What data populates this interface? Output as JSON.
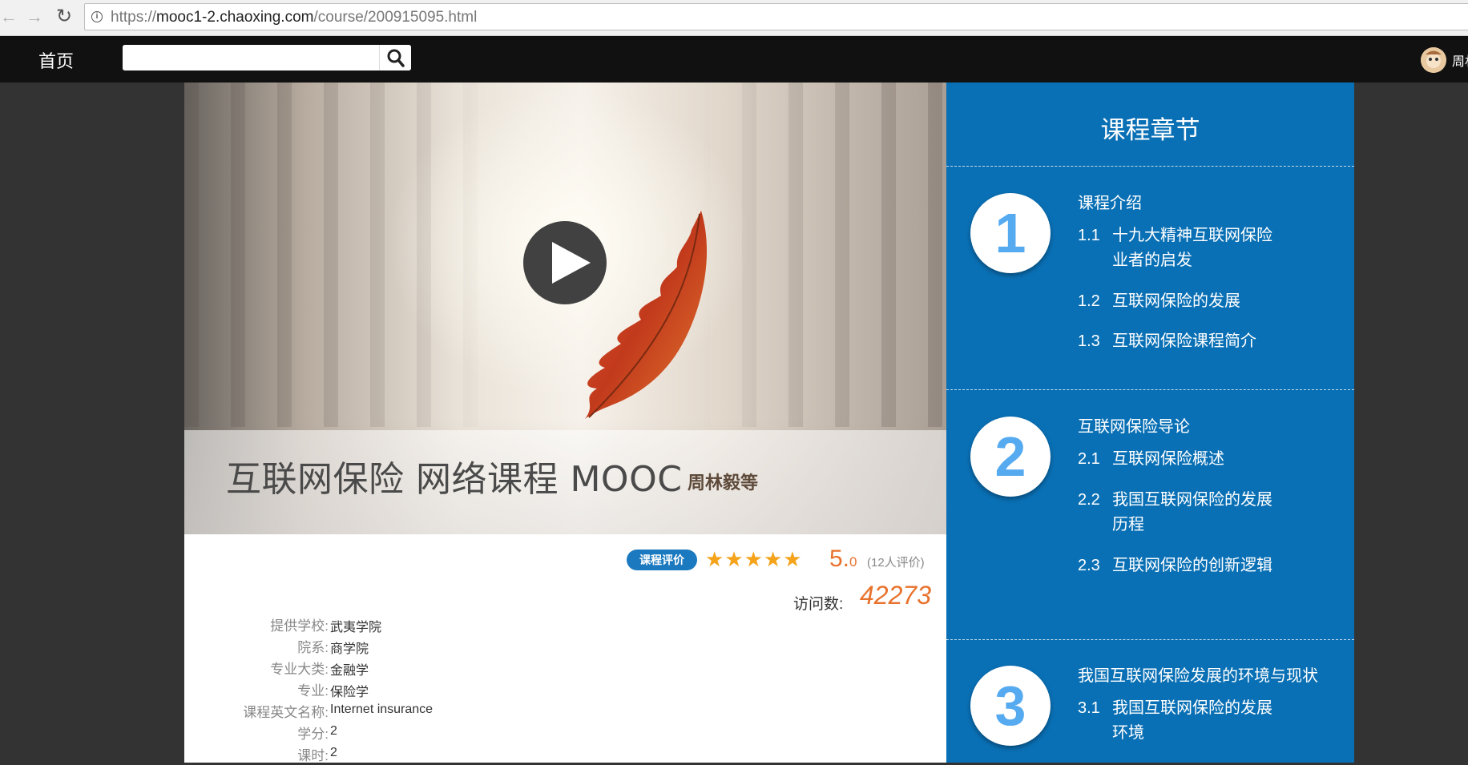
{
  "browser": {
    "url_scheme": "https://",
    "url_host": "mooc1-2.chaoxing.com",
    "url_path": "/course/200915095.html"
  },
  "nav": {
    "home_label": "首页",
    "search_placeholder": "",
    "user_name": "周林"
  },
  "hero": {
    "course_title": "互联网保险 网络课程 MOOC",
    "course_author": "周林毅等"
  },
  "rating": {
    "badge_label": "课程评价",
    "stars": 5,
    "score_int": "5.",
    "score_dec": "0",
    "review_count": "(12人评价)",
    "visits_label": "访问数:",
    "visits_value": "42273"
  },
  "meta": [
    {
      "label": "提供学校:",
      "value": "武夷学院"
    },
    {
      "label": "院系:",
      "value": "商学院"
    },
    {
      "label": "专业大类:",
      "value": "金融学"
    },
    {
      "label": "专业:",
      "value": "保险学"
    },
    {
      "label": "课程英文名称:",
      "value": "Internet insurance"
    },
    {
      "label": "学分:",
      "value": "2"
    },
    {
      "label": "课时:",
      "value": "2"
    }
  ],
  "chapters": {
    "heading": "课程章节",
    "items": [
      {
        "num": "1",
        "title": "课程介绍",
        "sections": [
          {
            "num": "1.1",
            "title": "十九大精神互联网保险业者的启发"
          },
          {
            "num": "1.2",
            "title": "互联网保险的发展"
          },
          {
            "num": "1.3",
            "title": "互联网保险课程简介"
          }
        ]
      },
      {
        "num": "2",
        "title": "互联网保险导论",
        "sections": [
          {
            "num": "2.1",
            "title": "互联网保险概述"
          },
          {
            "num": "2.2",
            "title": "我国互联网保险的发展历程"
          },
          {
            "num": "2.3",
            "title": "互联网保险的创新逻辑"
          }
        ]
      },
      {
        "num": "3",
        "title": "我国互联网保险发展的环境与现状",
        "sections": [
          {
            "num": "3.1",
            "title": "我国互联网保险的发展环境"
          }
        ]
      }
    ]
  },
  "colors": {
    "chapter_bg": "#0a70b5",
    "accent_orange": "#e8722c",
    "star_color": "#f4a31b",
    "badge_blue": "#1a79bf"
  }
}
